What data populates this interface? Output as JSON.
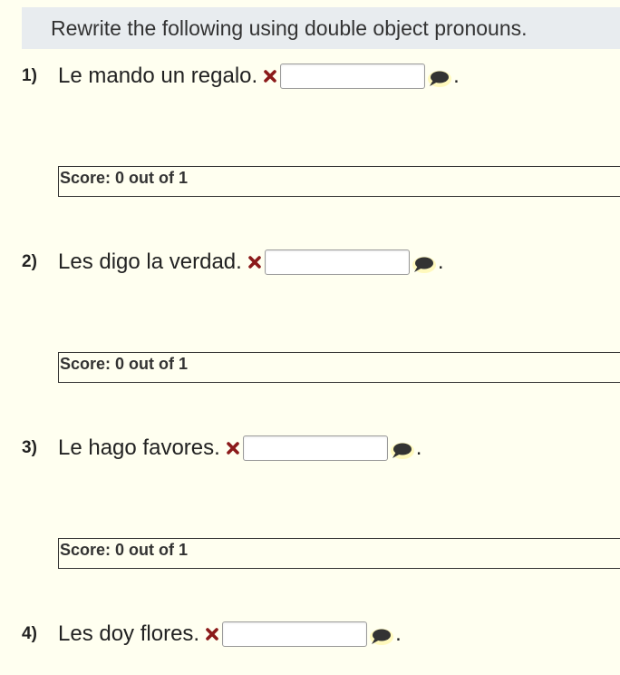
{
  "instructions": "Rewrite the following using double object pronouns.",
  "questions": [
    {
      "number": "1)",
      "text": "Le mando un regalo.",
      "answer": "",
      "period": ".",
      "score_label": "Score:",
      "score_value": "0 out of 1"
    },
    {
      "number": "2)",
      "text": "Les digo la verdad.",
      "answer": "",
      "period": ".",
      "score_label": "Score:",
      "score_value": "0 out of 1"
    },
    {
      "number": "3)",
      "text": "Le hago favores.",
      "answer": "",
      "period": ".",
      "score_label": "Score:",
      "score_value": "0 out of 1"
    },
    {
      "number": "4)",
      "text": "Les doy flores.",
      "answer": "",
      "period": "."
    }
  ],
  "icons": {
    "incorrect": "x-mark-icon",
    "comment": "speech-bubble-icon"
  },
  "colors": {
    "background": "#fffff0",
    "instructions_background": "#e8ecef",
    "incorrect_mark": "#8b1a1a",
    "comment_bubble": "#333333",
    "comment_glow": "#fff7b0"
  }
}
